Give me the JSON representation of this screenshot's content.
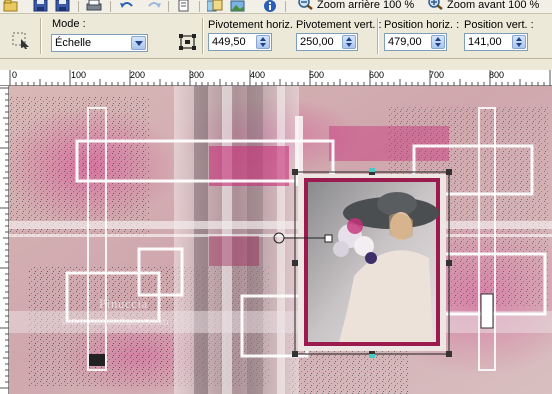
{
  "toolbar": {
    "zoom_out_label": "Zoom arrière 100 %",
    "zoom_in_label": "Zoom avant 100 %"
  },
  "options": {
    "mode": {
      "label": "Mode :",
      "value": "Échelle"
    },
    "pivot_h": {
      "label": "Pivotement horiz. :",
      "value": "449,50"
    },
    "pivot_v": {
      "label": "Pivotement vert. :",
      "value": "250,00"
    },
    "pos_h": {
      "label": "Position horiz. :",
      "value": "479,00"
    },
    "pos_v": {
      "label": "Position vert. :",
      "value": "141,00"
    }
  },
  "ruler": {
    "labels": [
      "0",
      "100",
      "200",
      "300",
      "400",
      "500",
      "600",
      "700",
      "800"
    ]
  },
  "canvas": {
    "watermark_line1": "Pinuccia",
    "watermark_line2": "www.tutorialspsp.com"
  },
  "colors": {
    "accent_pink": "#c8317a",
    "frame_border": "#9b1b4f",
    "handle": "#333333"
  }
}
